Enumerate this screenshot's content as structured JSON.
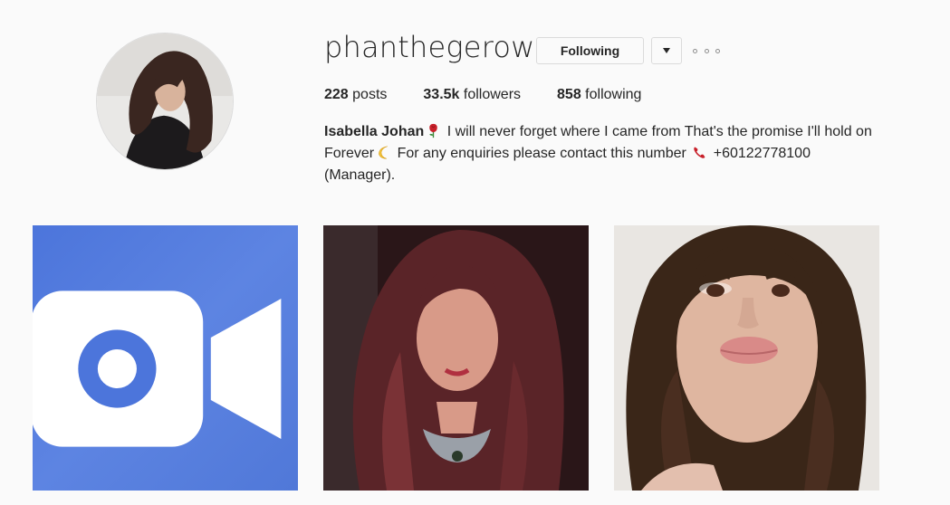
{
  "profile": {
    "username": "phanthegerow",
    "following_button": "Following",
    "stats": {
      "posts_count": "228",
      "posts_label": " posts",
      "followers_count": "33.5k",
      "followers_label": " followers",
      "following_count": "858",
      "following_label": " following"
    },
    "bio": {
      "full_name": "Isabella Johan",
      "text_1": " I will never forget where I came from That's the promise I'll hold on Forever",
      "text_2": " For any enquiries please contact this number ",
      "text_3": " +60122778100 (Manager)."
    }
  },
  "icons": {
    "rose": "rose-icon",
    "moon": "crescent-moon-icon",
    "phone": "telephone-icon",
    "video": "video-icon",
    "more": "more-options-icon"
  },
  "posts": [
    {
      "type": "video",
      "description_icon": "video-icon"
    },
    {
      "type": "photo"
    },
    {
      "type": "photo"
    }
  ],
  "colors": {
    "background": "#fafafa",
    "text": "#262626",
    "border": "#dbdbdb",
    "post1_blue": "#5b80e0"
  }
}
